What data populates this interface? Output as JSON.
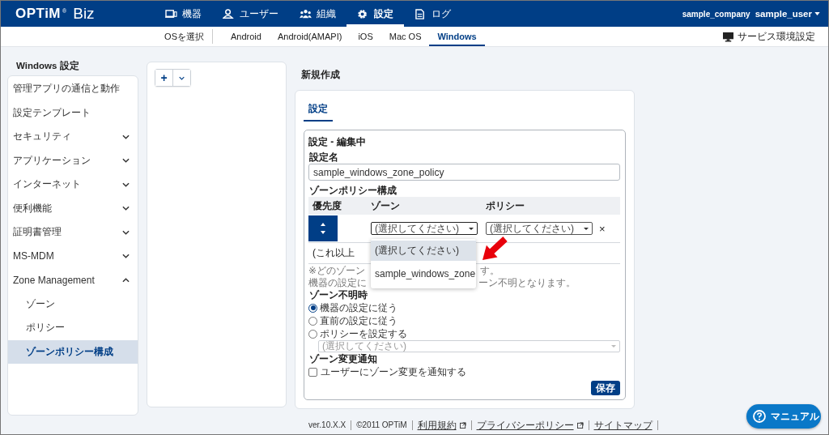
{
  "header": {
    "logo": "OPTiM",
    "logo_mark": "®",
    "logo_suffix": "Biz",
    "nav": [
      {
        "label": "機器",
        "selected": false
      },
      {
        "label": "ユーザー",
        "selected": false
      },
      {
        "label": "組織",
        "selected": false
      },
      {
        "label": "設定",
        "selected": true
      },
      {
        "label": "ログ",
        "selected": false
      }
    ],
    "company": "sample_company",
    "user": "sample_user"
  },
  "subnav": {
    "label": "OSを選択",
    "tabs": [
      {
        "label": "Android",
        "selected": false
      },
      {
        "label": "Android(AMAPI)",
        "selected": false
      },
      {
        "label": "iOS",
        "selected": false
      },
      {
        "label": "Mac OS",
        "selected": false
      },
      {
        "label": "Windows",
        "selected": true
      }
    ],
    "service_settings": "サービス環境設定"
  },
  "sidebar": {
    "title": "Windows 設定",
    "items": [
      {
        "label": "管理アプリの通信と動作",
        "kind": "link"
      },
      {
        "label": "設定テンプレート",
        "kind": "link"
      },
      {
        "label": "セキュリティ",
        "kind": "group",
        "expanded": false
      },
      {
        "label": "アプリケーション",
        "kind": "group",
        "expanded": false
      },
      {
        "label": "インターネット",
        "kind": "group",
        "expanded": false
      },
      {
        "label": "便利機能",
        "kind": "group",
        "expanded": false
      },
      {
        "label": "証明書管理",
        "kind": "group",
        "expanded": false
      },
      {
        "label": "MS-MDM",
        "kind": "group",
        "expanded": false
      },
      {
        "label": "Zone Management",
        "kind": "group",
        "expanded": true,
        "children": [
          {
            "label": "ゾーン",
            "selected": false
          },
          {
            "label": "ポリシー",
            "selected": false
          },
          {
            "label": "ゾーンポリシー構成",
            "selected": true
          }
        ]
      }
    ]
  },
  "list_panel": {
    "add": "+"
  },
  "main": {
    "title": "新規作成",
    "tabs": [
      {
        "label": "設定",
        "selected": true
      }
    ],
    "card_title": "設定 - 編集中",
    "name_label": "設定名",
    "name_value": "sample_windows_zone_policy",
    "zone_policy_label": "ゾーンポリシー構成",
    "columns": [
      "優先度",
      "ゾーン",
      "ポリシー"
    ],
    "row": {
      "zone": "(選択してください)",
      "policy": "(選択してください)",
      "delete": "×"
    },
    "more_note": "(これ以上",
    "hint_lines": [
      [
        "※どのゾーン",
        "す。"
      ],
      [
        "機器の設定に",
        "ーン不明となります。"
      ]
    ],
    "dropdown": [
      {
        "label": "(選択してください)",
        "selected": true
      },
      {
        "label": "sample_windows_zone",
        "selected": false
      }
    ],
    "unknown_label": "ゾーン不明時",
    "radios": [
      {
        "label": "機器の設定に従う",
        "selected": true
      },
      {
        "label": "直前の設定に従う",
        "selected": false
      },
      {
        "label": "ポリシーを設定する",
        "selected": false
      }
    ],
    "unknown_policy": {
      "placeholder": "(選択してください)",
      "disabled": true
    },
    "notify_label": "ゾーン変更通知",
    "notify_checkbox": {
      "label": "ユーザーにゾーン変更を通知する",
      "checked": false
    },
    "save": "保存"
  },
  "footer": {
    "version": "ver.10.X.X",
    "copyright": "©2011 OPTiM",
    "links": [
      {
        "label": "利用規約",
        "external": true
      },
      {
        "label": "プライバシーポリシー",
        "external": true
      },
      {
        "label": "サイトマップ",
        "external": false
      }
    ],
    "manual": "マニュアル"
  }
}
